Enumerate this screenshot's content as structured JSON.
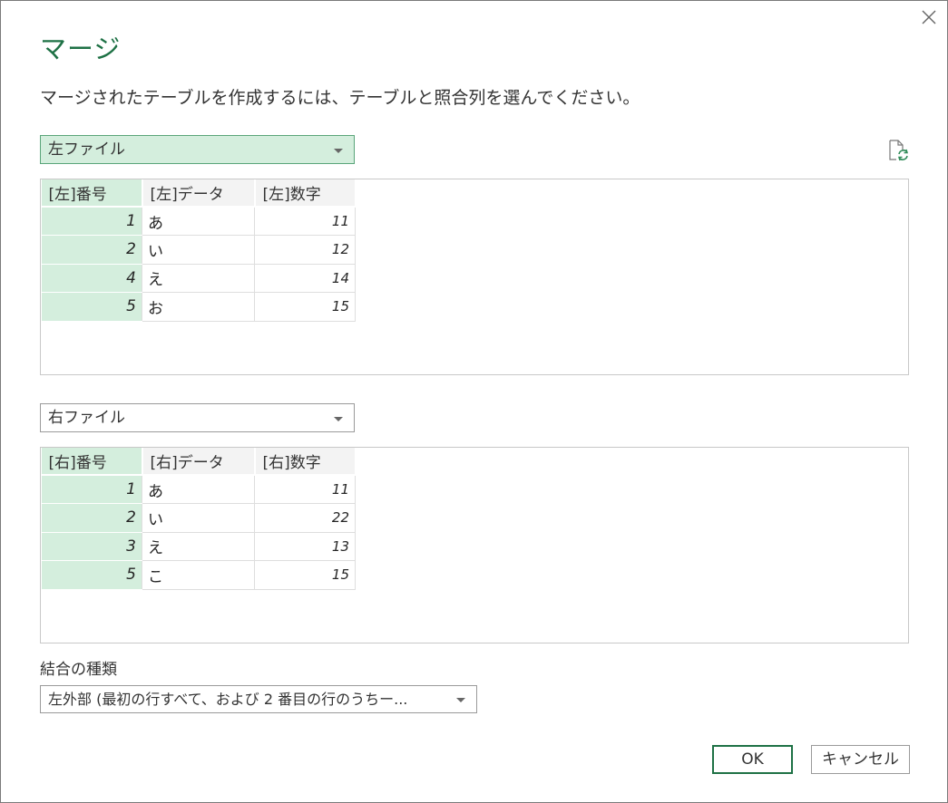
{
  "dialog": {
    "title": "マージ",
    "description": "マージされたテーブルを作成するには、テーブルと照合列を選んでください。"
  },
  "left": {
    "dropdown_value": "左ファイル",
    "columns": [
      "[左]番号",
      "[左]データ",
      "[左]数字"
    ],
    "rows": [
      [
        "1",
        "あ",
        "11"
      ],
      [
        "2",
        "い",
        "12"
      ],
      [
        "4",
        "え",
        "14"
      ],
      [
        "5",
        "お",
        "15"
      ]
    ]
  },
  "right": {
    "dropdown_value": "右ファイル",
    "columns": [
      "[右]番号",
      "[右]データ",
      "[右]数字"
    ],
    "rows": [
      [
        "1",
        "あ",
        "11"
      ],
      [
        "2",
        "い",
        "22"
      ],
      [
        "3",
        "え",
        "13"
      ],
      [
        "5",
        "こ",
        "15"
      ]
    ]
  },
  "join": {
    "label": "結合の種類",
    "selected": "左外部 (最初の行すべて、および 2 番目の行のうちー..."
  },
  "buttons": {
    "ok": "OK",
    "cancel": "キャンセル"
  },
  "icons": {
    "close": "close-icon",
    "refresh": "refresh-preview-icon",
    "dropdown": "chevron-down-icon"
  },
  "colors": {
    "accent": "#1e7145",
    "selected_fill": "#d4eedd"
  }
}
